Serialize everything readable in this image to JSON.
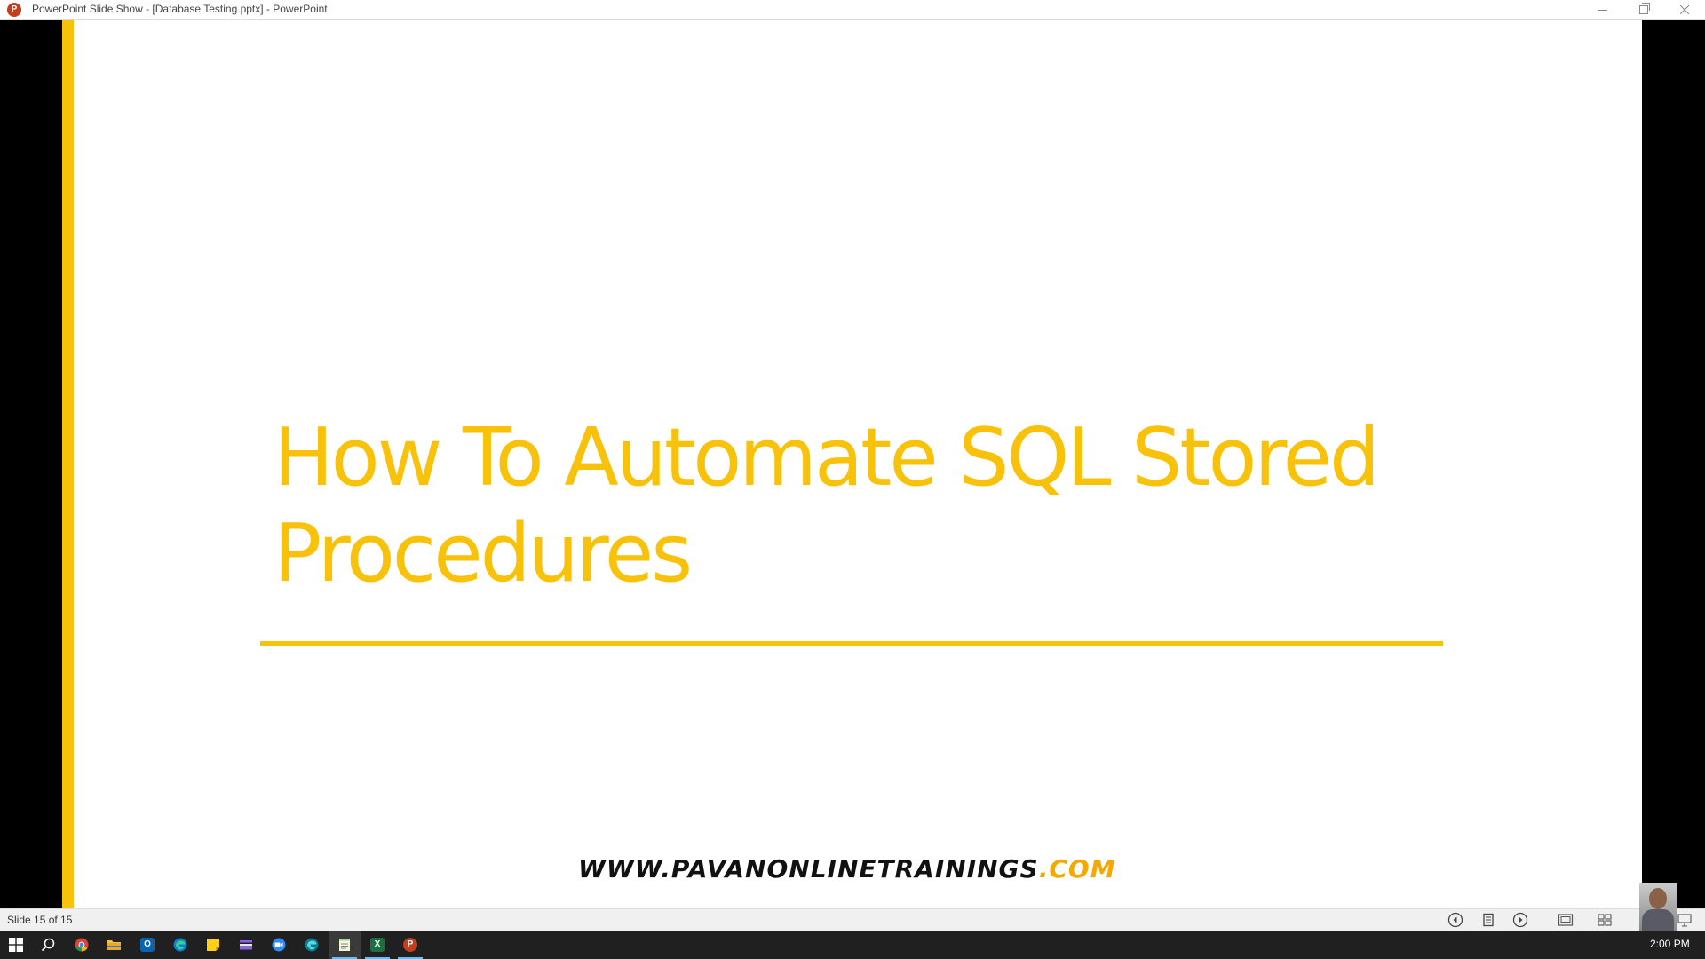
{
  "window": {
    "title": "PowerPoint Slide Show - [Database Testing.pptx] - PowerPoint",
    "app_icon_letter": "P"
  },
  "slide": {
    "title_line1": "How To Automate SQL Stored",
    "title_line2": "Procedures",
    "website_main": "WWW.PAVANONLINETRAININGS",
    "website_ext": ".COM",
    "accent_color": "#f9c20a"
  },
  "statusbar": {
    "slide_counter": "Slide 15 of 15"
  },
  "taskbar": {
    "apps": [
      {
        "name": "chrome",
        "active": false
      },
      {
        "name": "file-explorer",
        "active": false
      },
      {
        "name": "outlook",
        "letter": "O",
        "active": false
      },
      {
        "name": "edge",
        "active": false
      },
      {
        "name": "sticky-notes",
        "active": false
      },
      {
        "name": "app-bars",
        "active": false
      },
      {
        "name": "zoom",
        "active": false
      },
      {
        "name": "edge-dev",
        "active": false
      },
      {
        "name": "notepad",
        "active": true
      },
      {
        "name": "excel",
        "letter": "X",
        "active": true
      },
      {
        "name": "powerpoint",
        "letter": "P",
        "active": true
      }
    ],
    "clock": "2:00 PM"
  }
}
